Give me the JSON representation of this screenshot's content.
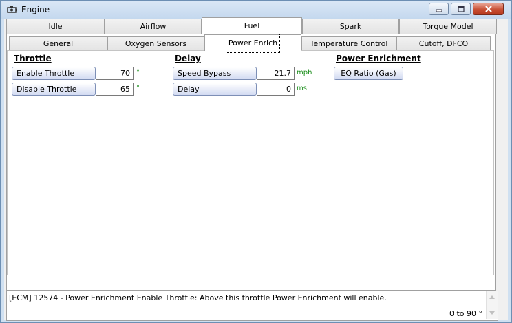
{
  "window": {
    "title": "Engine",
    "icon": "engine-icon",
    "controls": [
      "minimize-icon",
      "maximize-icon",
      "close-icon"
    ]
  },
  "tabs_top": [
    {
      "label": "Idle",
      "selected": false
    },
    {
      "label": "Airflow",
      "selected": false
    },
    {
      "label": "Fuel",
      "selected": true
    },
    {
      "label": "Spark",
      "selected": false
    },
    {
      "label": "Torque Model",
      "selected": false
    }
  ],
  "tabs_sub": [
    {
      "label": "General",
      "selected": false
    },
    {
      "label": "Oxygen Sensors",
      "selected": false
    },
    {
      "label": "Power Enrich",
      "selected": true
    },
    {
      "label": "Temperature Control",
      "selected": false
    },
    {
      "label": "Cutoff, DFCO",
      "selected": false
    }
  ],
  "groups": {
    "throttle": {
      "title": "Throttle",
      "rows": [
        {
          "label": "Enable Throttle",
          "value": "70",
          "unit": "°"
        },
        {
          "label": "Disable Throttle",
          "value": "65",
          "unit": "°"
        }
      ]
    },
    "delay": {
      "title": "Delay",
      "rows": [
        {
          "label": "Speed Bypass",
          "value": "21.7",
          "unit": "mph"
        },
        {
          "label": "Delay",
          "value": "0",
          "unit": "ms"
        }
      ]
    },
    "power_enrichment": {
      "title": "Power Enrichment",
      "button": "EQ Ratio (Gas)"
    }
  },
  "status": {
    "message": "[ECM] 12574 - Power Enrichment Enable Throttle: Above this throttle Power Enrichment will enable.",
    "range": "0 to 90 °"
  },
  "colors": {
    "unit_text": "#1d8f1d",
    "title_bar": "#cfe0f1",
    "close_button": "#c74f34"
  }
}
